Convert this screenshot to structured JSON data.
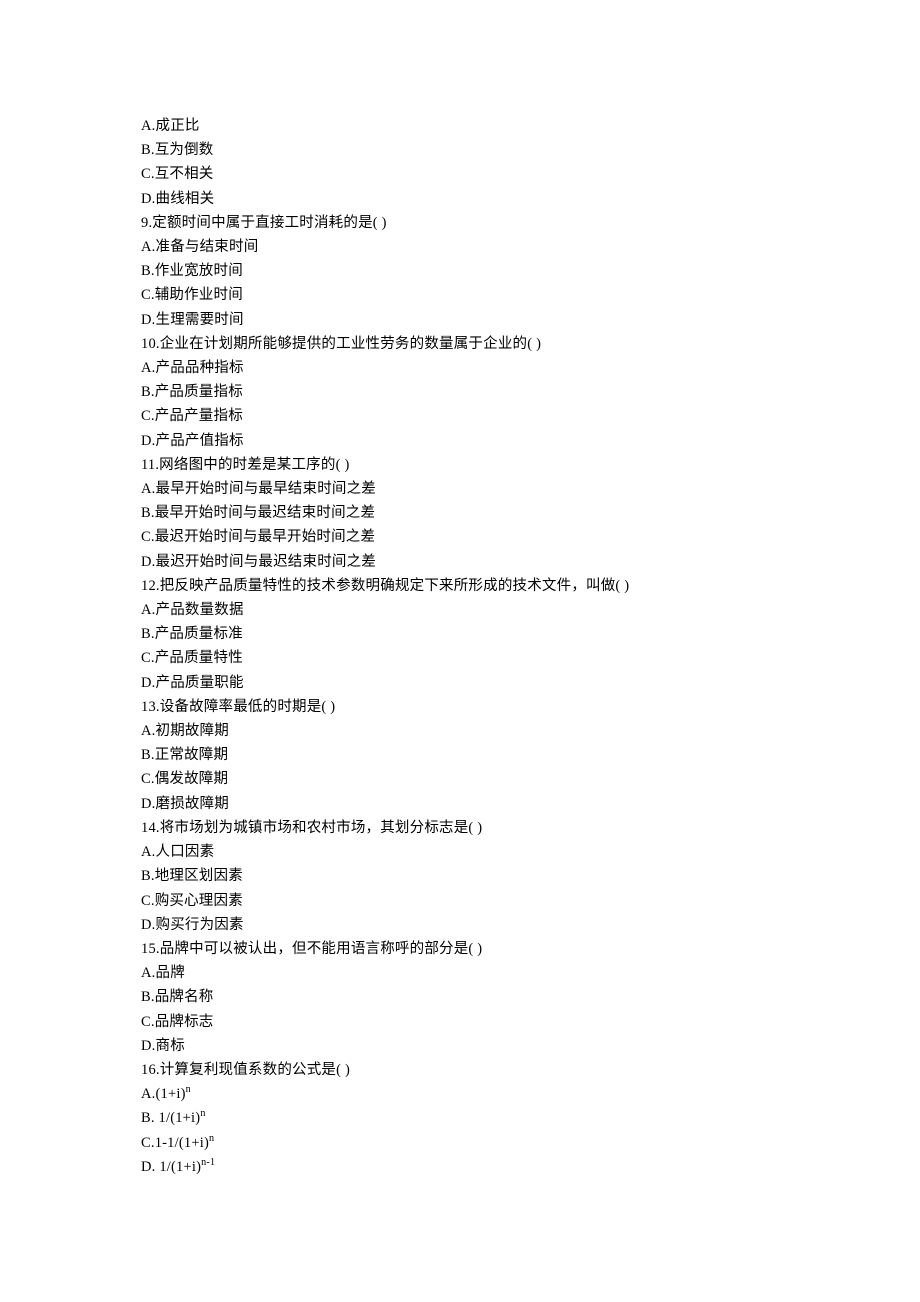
{
  "lines": [
    "A.成正比",
    "B.互为倒数",
    "C.互不相关",
    "D.曲线相关",
    "9.定额时间中属于直接工时消耗的是( )",
    "A.准备与结束时间",
    "B.作业宽放时间",
    "C.辅助作业时间",
    "D.生理需要时间",
    "10.企业在计划期所能够提供的工业性劳务的数量属于企业的( )",
    "A.产品品种指标",
    "B.产品质量指标",
    "C.产品产量指标",
    "D.产品产值指标",
    "11.网络图中的时差是某工序的( )",
    "A.最早开始时间与最早结束时间之差",
    "B.最早开始时间与最迟结束时间之差",
    "C.最迟开始时间与最早开始时间之差",
    "D.最迟开始时间与最迟结束时间之差",
    "12.把反映产品质量特性的技术参数明确规定下来所形成的技术文件，叫做( )",
    "A.产品数量数据",
    "B.产品质量标准",
    "C.产品质量特性",
    "D.产品质量职能",
    "13.设备故障率最低的时期是( )",
    "A.初期故障期",
    "B.正常故障期",
    "C.偶发故障期",
    "D.磨损故障期",
    "14.将市场划为城镇市场和农村市场，其划分标志是( )",
    "A.人口因素",
    "B.地理区划因素",
    "C.购买心理因素",
    "D.购买行为因素",
    "15.品牌中可以被认出，但不能用语言称呼的部分是( )",
    "A.品牌",
    "B.品牌名称",
    "C.品牌标志",
    "D.商标",
    "16.计算复利现值系数的公式是( )",
    "A.(1+i)<sup>n</sup>",
    "B. 1/(1+i)<sup>n</sup>",
    "C.1-1/(1+i)<sup>n</sup>",
    "D. 1/(1+i)<sup>n-1</sup>"
  ]
}
